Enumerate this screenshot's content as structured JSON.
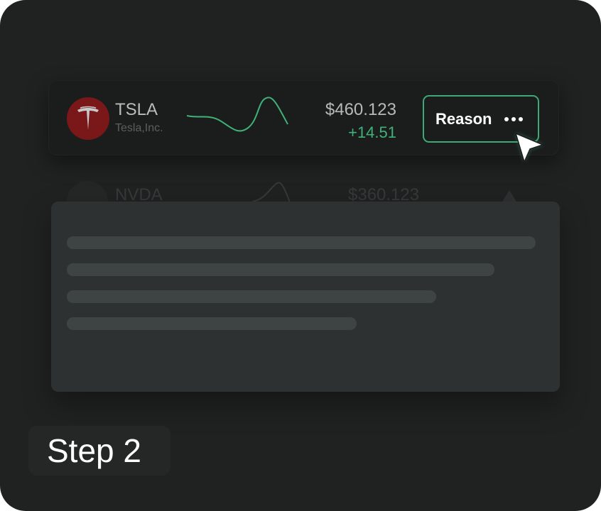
{
  "stock": {
    "ticker": "TSLA",
    "company": "Tesla,Inc.",
    "price": "$460.123",
    "change": "+14.51",
    "action_label": "Reason"
  },
  "faded_row": {
    "ticker": "NVDA",
    "price": "$360.123"
  },
  "popover": {
    "skeleton_lines": 4
  },
  "step_label": "Step 2",
  "colors": {
    "background": "#202222",
    "card": "#1b1d1d",
    "accent_green": "#3fb27a",
    "tesla_red": "#7a1719",
    "popover": "#2e3131",
    "skeleton": "#3e4444"
  },
  "icons": [
    "tesla-logo-icon",
    "sparkline-chart",
    "more-dots-icon",
    "cursor-pointer-icon",
    "nvidia-logo-icon"
  ]
}
